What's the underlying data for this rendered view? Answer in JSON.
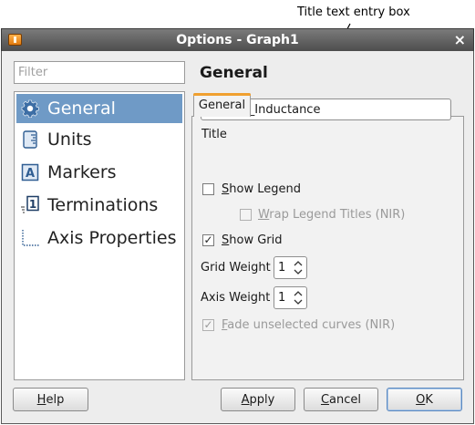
{
  "annotation": {
    "callout_text": "Title text entry box"
  },
  "window": {
    "title": "Options - Graph1",
    "close_glyph": "×"
  },
  "filter": {
    "placeholder": "Filter",
    "value": ""
  },
  "nav": {
    "items": [
      {
        "label": "General",
        "icon": "gear-icon",
        "selected": true
      },
      {
        "label": "Units",
        "icon": "units-icon",
        "selected": false
      },
      {
        "label": "Markers",
        "icon": "markers-icon",
        "selected": false
      },
      {
        "label": "Terminations",
        "icon": "terminations-icon",
        "selected": false
      },
      {
        "label": "Axis Properties",
        "icon": "axis-properties-icon",
        "selected": false
      }
    ]
  },
  "panel": {
    "heading": "General",
    "tab_label": "General",
    "title_label": "Title",
    "title_value": "Tutorial_Inductance",
    "show_legend": {
      "label_first": "S",
      "label_rest": "how Legend",
      "checked": false
    },
    "wrap_legend": {
      "label_first": "W",
      "label_rest": "rap Legend Titles (NIR)",
      "checked": false,
      "enabled": false
    },
    "show_grid": {
      "label_first": "S",
      "label_rest": "how Grid",
      "checked": true
    },
    "grid_weight": {
      "label": "Grid Weight",
      "value": "1"
    },
    "axis_weight": {
      "label": "Axis Weight",
      "value": "1"
    },
    "fade_curves": {
      "label_first": "F",
      "label_rest": "ade unselected curves (NIR)",
      "checked": true,
      "enabled": false
    }
  },
  "buttons": {
    "help": {
      "first": "H",
      "rest": "elp"
    },
    "apply": {
      "first": "A",
      "rest": "pply"
    },
    "cancel": {
      "first": "C",
      "rest": "ancel"
    },
    "ok": {
      "first": "O",
      "rest": "K"
    }
  },
  "colors": {
    "selection": "#6f9ac6",
    "tab_accent": "#f0a030",
    "titlebar": "#5a5a5a"
  }
}
